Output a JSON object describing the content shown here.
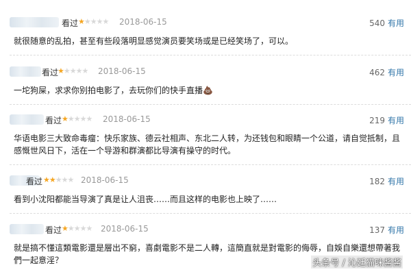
{
  "reviews": [
    {
      "status": "看过",
      "rating": 1,
      "star_full": "★",
      "star_empty": "★★★★",
      "date": "2018-06-15",
      "useful_count": "540",
      "useful_label": "有用",
      "content": "就很随意的乱拍，甚至有些段落明显感觉演员要笑场或是已经笑场了，可以。"
    },
    {
      "status": "看过",
      "rating": 1,
      "star_full": "★",
      "star_empty": "★★★★",
      "date": "2018-06-15",
      "useful_count": "462",
      "useful_label": "有用",
      "content": "一坨狗屎，求求你别拍电影了，去玩你们的快手直播💩"
    },
    {
      "status": "看过",
      "rating": 1,
      "star_full": "★",
      "star_empty": "★★★★",
      "date": "2018-06-15",
      "useful_count": "219",
      "useful_label": "有用",
      "content": "华语电影三大致命毒瘤：快乐家族、德云社相声、东北二人转，为还钱包和眼睛一个公道，请自觉抵制，且感慨世风日下，活在一个导游和群演都比导演有操守的时代。"
    },
    {
      "status": "看过",
      "rating": 2,
      "star_full": "★★",
      "star_empty": "★★★",
      "date": "2018-06-15",
      "useful_count": "182",
      "useful_label": "有用",
      "content": "看到小沈阳都能当导演了真是让人沮丧……而且这样的电影也上映了……"
    },
    {
      "status": "看过",
      "rating": 1,
      "star_full": "★",
      "star_empty": "★★★★",
      "date": "2018-06-15",
      "useful_count": "137",
      "useful_label": "有用",
      "content": "就是搞不懂這類電影還是層出不窮，喜劇電影不是二人轉，這簡直就是對電影的侮辱，自娛自樂還想帶著我們一起意淫？"
    }
  ],
  "watermark": "头条号 / 沁廷猫咪酱酱"
}
